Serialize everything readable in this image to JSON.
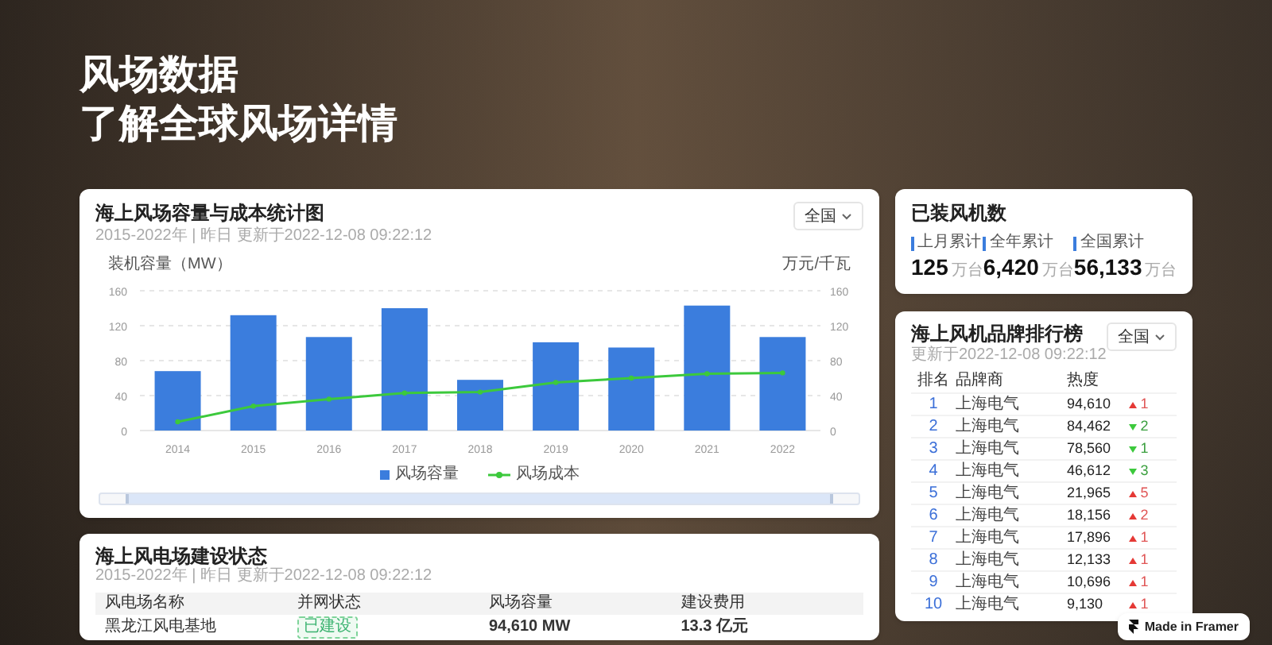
{
  "hero": {
    "title": "风场数据",
    "subtitle": "了解全球风场详情"
  },
  "chart_card": {
    "title": "海上风场容量与成本统计图",
    "meta": "2015-2022年 | 昨日 更新于2022-12-08 09:22:12",
    "region_select": "全国",
    "right_axis_title": "万元/千瓦",
    "left_axis_ticks": [
      "160",
      "120",
      "80",
      "40",
      "0"
    ],
    "right_axis_ticks": [
      "160",
      "120",
      "80",
      "40",
      "0"
    ],
    "chart_data": {
      "type": "bar",
      "ylabel": "装机容量（MW）",
      "categories": [
        "2014",
        "2015",
        "2016",
        "2017",
        "2018",
        "2019",
        "2020",
        "2021",
        "2022"
      ],
      "ylim": [
        0,
        160
      ],
      "yticks": [
        0,
        40,
        80,
        120,
        160
      ],
      "grid": true,
      "legend": true,
      "series": [
        {
          "name": "风场容量",
          "type": "bar",
          "color": "#3b7ddd",
          "values": [
            68,
            132,
            107,
            140,
            58,
            101,
            95,
            143,
            107
          ]
        },
        {
          "name": "风场成本",
          "type": "line",
          "marker": "circle",
          "color": "#3cc93c",
          "values": [
            10,
            28,
            36,
            43,
            44,
            55,
            60,
            65,
            66
          ]
        }
      ]
    }
  },
  "build_card": {
    "title": "海上风电场建设状态",
    "meta": "2015-2022年 | 昨日 更新于2022-12-08 09:22:12",
    "columns": [
      "风电场名称",
      "并网状态",
      "风场容量",
      "建设费用"
    ],
    "rows": [
      {
        "name": "黑龙江风电基地",
        "status": {
          "label": "已建设",
          "kind": "built"
        },
        "capacity": "94,610 MW",
        "cost": "13.3 亿元"
      }
    ]
  },
  "stats_card": {
    "title": "已装风机数",
    "items": [
      {
        "label": "上月累计",
        "value": "125",
        "unit": "万台"
      },
      {
        "label": "全年累计",
        "value": "6,420",
        "unit": "万台"
      },
      {
        "label": "全国累计",
        "value": "56,133",
        "unit": "万台"
      }
    ]
  },
  "ranking_card": {
    "title": "海上风机品牌排行榜",
    "meta": "更新于2022-12-08 09:22:12",
    "region_select": "全国",
    "columns": [
      "排名",
      "品牌商",
      "热度"
    ],
    "rows": [
      {
        "rank": "1",
        "brand": "上海电气",
        "heat": "94,610",
        "rising": true,
        "change": "1"
      },
      {
        "rank": "2",
        "brand": "上海电气",
        "heat": "84,462",
        "rising": false,
        "change": "2"
      },
      {
        "rank": "3",
        "brand": "上海电气",
        "heat": "78,560",
        "rising": false,
        "change": "1"
      },
      {
        "rank": "4",
        "brand": "上海电气",
        "heat": "46,612",
        "rising": false,
        "change": "3"
      },
      {
        "rank": "5",
        "brand": "上海电气",
        "heat": "21,965",
        "rising": true,
        "change": "5"
      },
      {
        "rank": "6",
        "brand": "上海电气",
        "heat": "18,156",
        "rising": true,
        "change": "2"
      },
      {
        "rank": "7",
        "brand": "上海电气",
        "heat": "17,896",
        "rising": true,
        "change": "1"
      },
      {
        "rank": "8",
        "brand": "上海电气",
        "heat": "12,133",
        "rising": true,
        "change": "1"
      },
      {
        "rank": "9",
        "brand": "上海电气",
        "heat": "10,696",
        "rising": true,
        "change": "1"
      },
      {
        "rank": "10",
        "brand": "上海电气",
        "heat": "9,130",
        "rising": true,
        "change": "1"
      }
    ]
  },
  "badge": {
    "label": "Made in Framer"
  }
}
